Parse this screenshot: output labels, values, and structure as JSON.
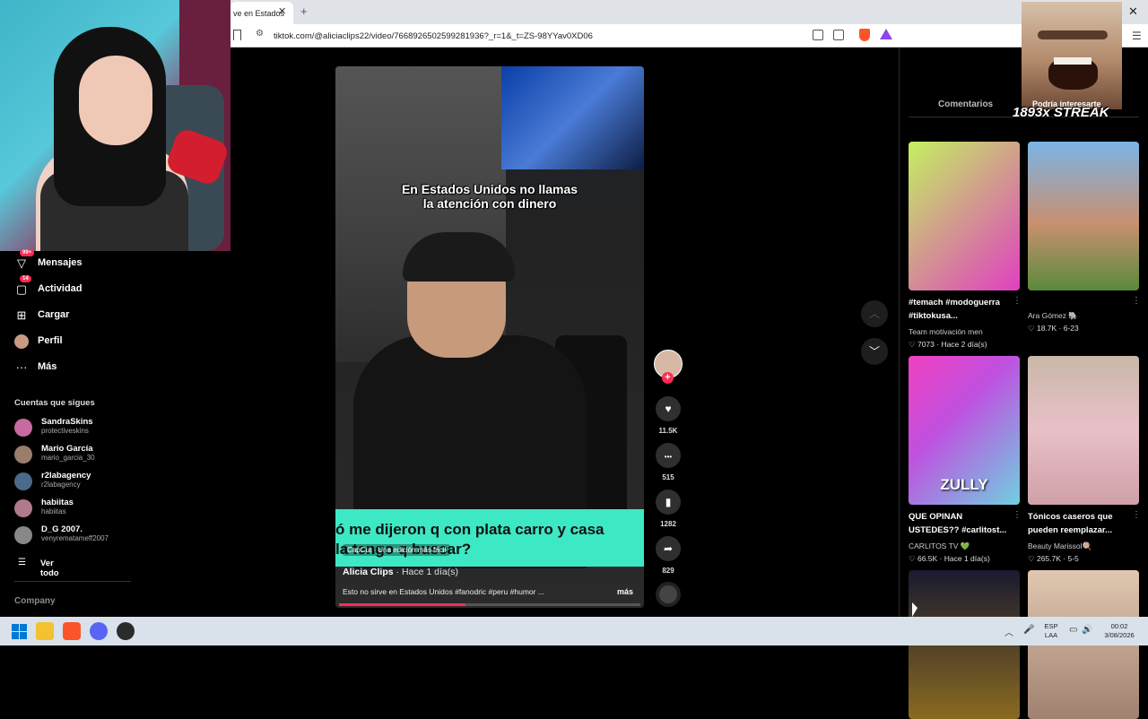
{
  "browser": {
    "tab_title": "ve en Estados",
    "tab_close": "✕",
    "new_tab": "+",
    "window_close": "✕",
    "url": "tiktok.com/@aliciaclips22/video/7668926502599281936?_r=1&_t=ZS-98YYav0XD06",
    "site_icon": "⚙",
    "menu_icon": "☰"
  },
  "sidebar": {
    "items": [
      {
        "label": "Mensajes",
        "icon": "paper-plane-icon",
        "glyph": "▽",
        "badge": "99+"
      },
      {
        "label": "Actividad",
        "icon": "inbox-icon",
        "glyph": "▢",
        "badge": "14"
      },
      {
        "label": "Cargar",
        "icon": "plus-box-icon",
        "glyph": "⊞",
        "badge": ""
      },
      {
        "label": "Perfil",
        "icon": "avatar-icon",
        "glyph": "●",
        "badge": ""
      },
      {
        "label": "Más",
        "icon": "more-icon",
        "glyph": "···",
        "badge": ""
      }
    ],
    "following_heading": "Cuentas que sigues",
    "following": [
      {
        "name": "SandraSkins",
        "handle": "protectiveskins",
        "color": "#c86aa0"
      },
      {
        "name": "Mario García",
        "handle": "mario_garcia_30",
        "color": "#9a7d6c"
      },
      {
        "name": "r2labagency",
        "handle": "r2labagency",
        "color": "#4a6a8a"
      },
      {
        "name": "habiitas",
        "handle": "habiitas",
        "color": "#b07a8c"
      },
      {
        "name": "D_G 2007.",
        "handle": "venyrematameff2007",
        "color": "#888888"
      }
    ],
    "see_all": "Ver todo",
    "see_all_glyph": "☰",
    "company": "Company"
  },
  "video": {
    "caption_top_1": "En Estados Unidos no llamas",
    "caption_top_2": "la atención con dinero",
    "banner_text_1": "ó me dijeron q con plata carro y casa",
    "banner_text_2": "la tengo q buscar?",
    "capcut": "CapCut · Una edición más fácil",
    "author": "Alicia Clips",
    "time": " · Hace 1 día(s)",
    "description": "Esto no sirve en Estados Unidos #fanodric #peru #humor ...",
    "more": "más",
    "progress": 0.42
  },
  "actions": {
    "follow_plus": "+",
    "like_glyph": "♥",
    "likes": "11.5K",
    "comment_glyph": "•••",
    "comments": "515",
    "save_glyph": "▮",
    "saves": "1282",
    "share_glyph": "➦",
    "shares": "829",
    "prev_glyph": "︿",
    "next_glyph": "﹀"
  },
  "panel": {
    "tab_comments": "Comentarios",
    "tab_recommendations": "Podría interesarte",
    "cards": [
      {
        "title": "#temach #modoguerra #tiktokusa...",
        "author": "Team motivación men",
        "meta": "♡ 7073 · Hace 2 día(s)",
        "bg": "linear-gradient(135deg,#c4f060,#e040c0)"
      },
      {
        "title": "",
        "author": "Ara Gómez 🐘",
        "meta": "♡ 18.7K · 6-23",
        "bg": "linear-gradient(180deg,#7ab4e6,#c89070 55%,#5a8a3a)"
      },
      {
        "title": "QUE OPINAN USTEDES?? #carlitost...",
        "author": "CARLITOS TV 💚",
        "meta": "♡ 66.5K · Hace 1 día(s)",
        "bg": "linear-gradient(135deg,#f040c0,#c050e0 40%,#70d0e0)"
      },
      {
        "title": "Tónicos caseros que pueden reemplazar...",
        "author": "Beauty Marissol🍭",
        "meta": "♡ 265.7K · 5-5",
        "bg": "linear-gradient(180deg,#c8b8a8,#e8c0c8 50%,#d0a0a8)"
      },
      {
        "title": "",
        "author": "",
        "meta": "",
        "bg": "linear-gradient(180deg,#1a1a30,#8a6a20)"
      },
      {
        "title": "",
        "author": "",
        "meta": "",
        "bg": "linear-gradient(180deg,#e0c8b0,#a08070)"
      }
    ],
    "zully": "ZULLY",
    "card_more": "⋮"
  },
  "overlay": {
    "streak": "1893x STREAK"
  },
  "taskbar": {
    "lang_1": "ESP",
    "lang_2": "LAA",
    "time": "00:02",
    "date": "3/08/2026",
    "tray_up": "︿",
    "tray_mic": "🎤",
    "tray_net": "▭",
    "tray_vol": "🔊"
  }
}
